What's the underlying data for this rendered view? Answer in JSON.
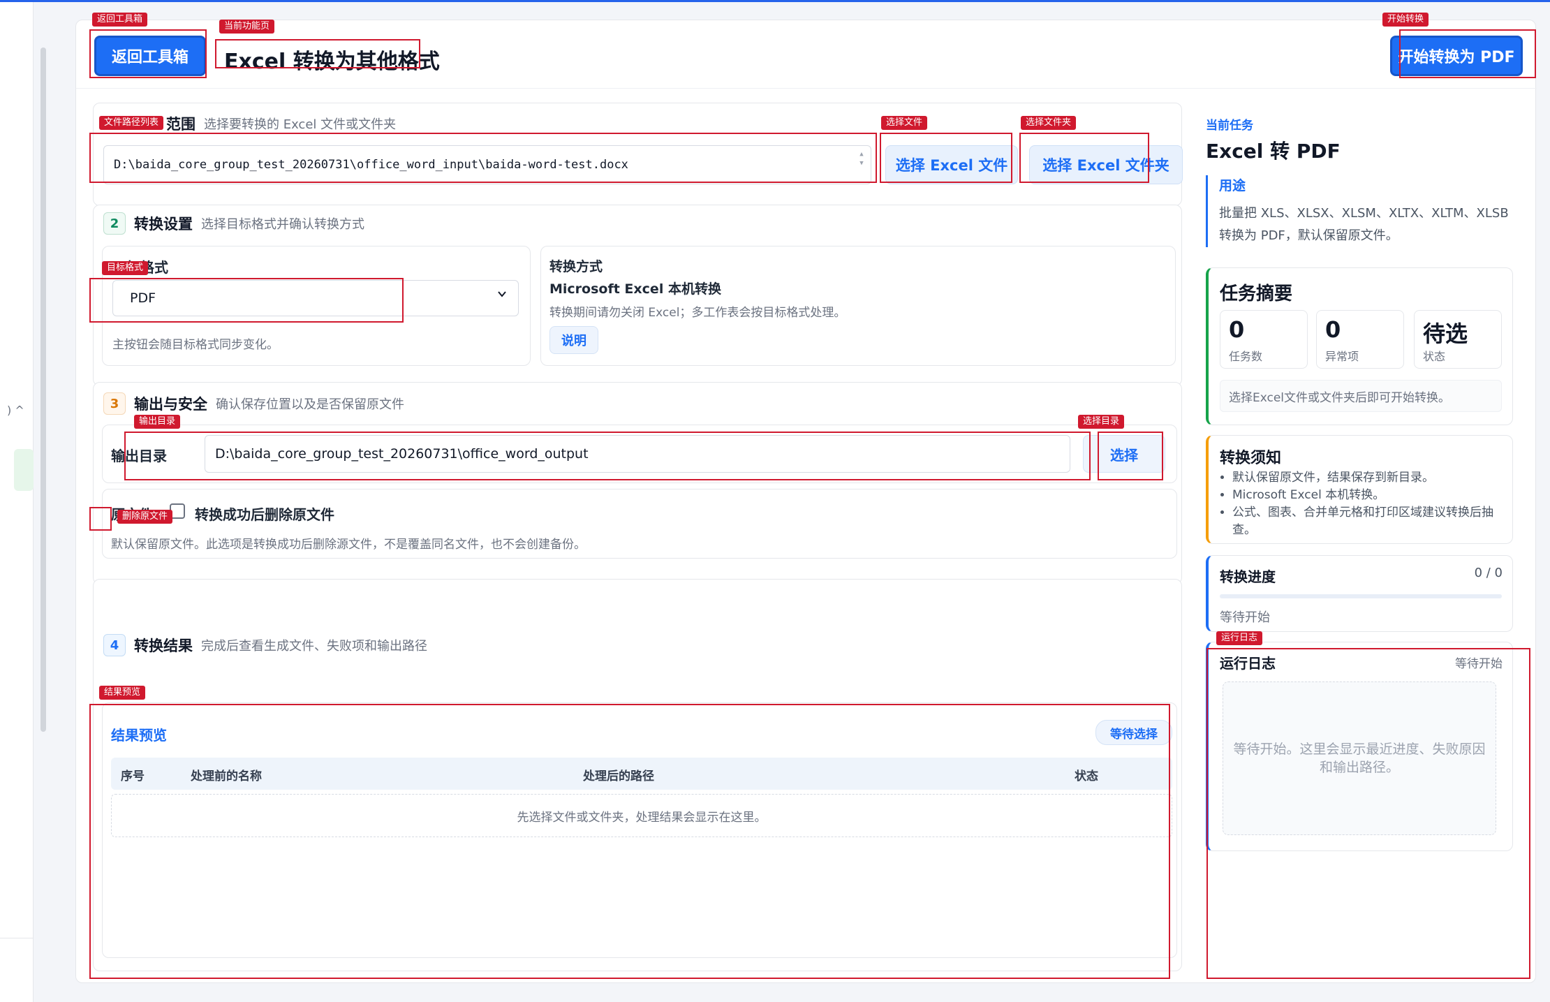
{
  "header": {
    "back_button": "返回工具箱",
    "page_title": "Excel 转换为其他格式",
    "start_button": "开始转换为 PDF"
  },
  "section1": {
    "title": "范围",
    "subtitle": "选择要转换的 Excel 文件或文件夹",
    "path": "D:\\baida_core_group_test_20260731\\office_word_input\\baida-word-test.docx",
    "choose_file": "选择 Excel 文件",
    "choose_folder": "选择 Excel 文件夹"
  },
  "section2": {
    "num": "2",
    "title": "转换设置",
    "subtitle": "选择目标格式并确认转换方式",
    "target_label": "目标格式",
    "target_value": "PDF",
    "target_hint": "主按钮会随目标格式同步变化。",
    "method_label": "转换方式",
    "method_value": "Microsoft Excel 本机转换",
    "method_hint": "转换期间请勿关闭 Excel；多工作表会按目标格式处理。",
    "explain_button": "说明"
  },
  "section3": {
    "num": "3",
    "title": "输出与安全",
    "subtitle": "确认保存位置以及是否保留原文件",
    "output_label": "输出目录",
    "output_value": "D:\\baida_core_group_test_20260731\\office_word_output",
    "choose_button": "选择",
    "orig_label": "原文件",
    "delete_label": "转换成功后删除原文件",
    "delete_hint": "默认保留原文件。此选项是转换成功后删除源文件，不是覆盖同名文件，也不会创建备份。"
  },
  "section4": {
    "num": "4",
    "title": "转换结果",
    "subtitle": "完成后查看生成文件、失败项和输出路径",
    "preview_title": "结果预览",
    "status_pill": "等待选择",
    "columns": [
      "序号",
      "处理前的名称",
      "处理后的路径",
      "状态"
    ],
    "empty_text": "先选择文件或文件夹，处理结果会显示在这里。"
  },
  "sidebar": {
    "kicker": "当前任务",
    "task_title": "Excel 转 PDF",
    "usage_title": "用途",
    "usage_text": "批量把 XLS、XLSX、XLSM、XLTX、XLTM、XLSB 转换为 PDF，默认保留原文件。",
    "summary_title": "任务摘要",
    "stats": [
      {
        "value": "0",
        "label": "任务数"
      },
      {
        "value": "0",
        "label": "异常项"
      },
      {
        "value": "待选",
        "label": "状态"
      }
    ],
    "summary_note": "选择Excel文件或文件夹后即可开始转换。",
    "notice_title": "转换须知",
    "notice_items": [
      "默认保留原文件，结果保存到新目录。",
      "Microsoft Excel 本机转换。",
      "公式、图表、合并单元格和打印区域建议转换后抽查。"
    ],
    "progress_title": "转换进度",
    "progress_count": "0 / 0",
    "progress_fraction": 0,
    "progress_status": "等待开始",
    "log_title": "运行日志",
    "log_status": "等待开始",
    "log_text": "等待开始。这里会显示最近进度、失败原因和输出路径。"
  },
  "annotations": {
    "back": "返回工具箱",
    "current_page": "当前功能页",
    "start": "开始转换",
    "file_list": "文件路径列表",
    "select_file": "选择文件",
    "select_folder": "选择文件夹",
    "target_format": "目标格式",
    "output_dir": "输出目录",
    "select_dir": "选择目录",
    "delete_orig": "删除原文件",
    "result_preview": "结果预览",
    "run_log": "运行日志"
  },
  "colors": {
    "accent": "#1d6ef5",
    "annotation": "#d0192e",
    "success": "#16a34a",
    "warning": "#f59e0b"
  }
}
